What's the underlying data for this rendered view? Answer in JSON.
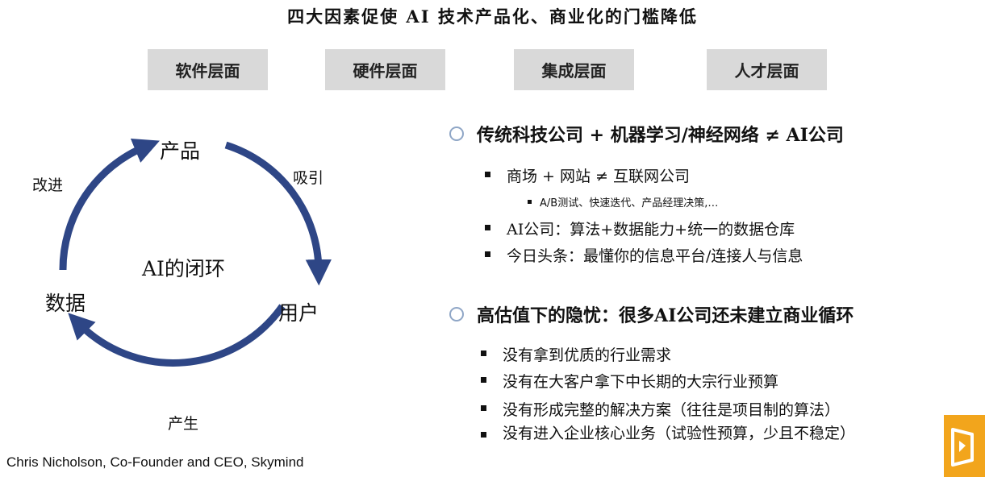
{
  "title": "四大因素促使 AI 技术产品化、商业化的门槛降低",
  "layers": [
    "软件层面",
    "硬件层面",
    "集成层面",
    "人才层面"
  ],
  "cycle": {
    "center": "AI的闭环",
    "nodes": {
      "product": "产品",
      "user": "用户",
      "data": "数据"
    },
    "edges": {
      "attract": "吸引",
      "produce": "产生",
      "improve": "改进"
    },
    "arrow_color": "#2e4686"
  },
  "credit": "Chris Nicholson, Co-Founder and CEO, Skymind",
  "sections": [
    {
      "heading": "传统科技公司 + 机器学习/神经网络 ≠ AI公司",
      "items": [
        {
          "text": "商场 + 网站 ≠ 互联网公司",
          "sub": [
            "A/B测试、快速迭代、产品经理决策,…"
          ]
        },
        {
          "text": "AI公司：算法+数据能力+统一的数据仓库"
        },
        {
          "text": "今日头条：最懂你的信息平台/连接人与信息"
        }
      ]
    },
    {
      "heading": "高估值下的隐忧：很多AI公司还未建立商业循环",
      "items": [
        {
          "text": "没有拿到优质的行业需求"
        },
        {
          "text": "没有在大客户拿下中长期的大宗行业预算"
        },
        {
          "text": "没有形成完整的解决方案（往往是项目制的算法）"
        },
        {
          "text": "没有进入企业核心业务（试验性预算，少且不稳定）"
        }
      ]
    }
  ],
  "colors": {
    "layer_bg": "#d9d9d9",
    "bullet_circle": "#8fa6c6",
    "badge": "#f2a51c"
  }
}
